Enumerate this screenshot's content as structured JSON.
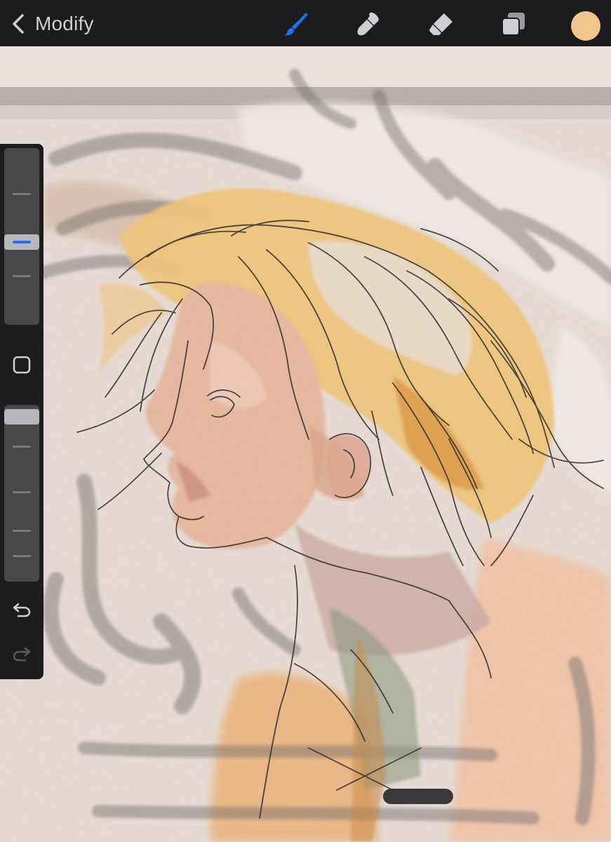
{
  "topbar": {
    "back_label": "Modify",
    "active_tool": "brush",
    "tools": [
      "brush-icon",
      "smudge-icon",
      "eraser-icon",
      "layers-icon"
    ],
    "current_color": "#F1C58C",
    "accent_color": "#1F6FF2"
  },
  "sidebar": {
    "size_slider_level": 0.53,
    "opacity_slider_level": 1.0,
    "modify_icon": "square-icon",
    "undo_icon": "undo-icon",
    "redo_icon": "redo-icon"
  },
  "canvas": {
    "subject": "drawing-canvas"
  }
}
